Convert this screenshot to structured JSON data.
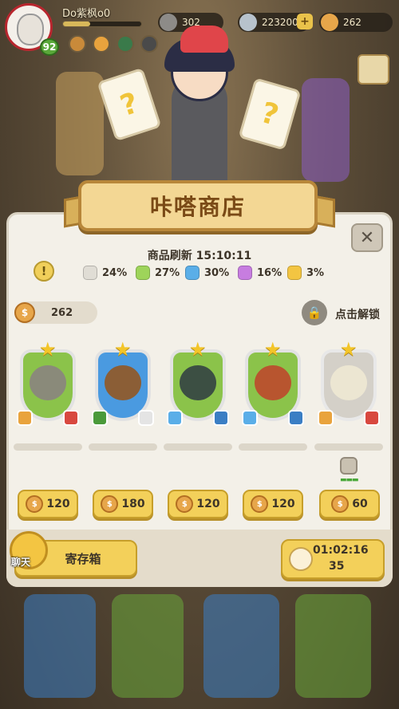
{
  "player": {
    "name": "Do紫枫o0",
    "level": "92"
  },
  "resources": [
    {
      "name": "stamina",
      "value": "302",
      "icon": "energy-icon"
    },
    {
      "name": "stones",
      "value": "223200",
      "icon": "stone-icon"
    },
    {
      "name": "coins",
      "value": "262",
      "icon": "coin-icon"
    }
  ],
  "shop": {
    "title": "咔嗒商店",
    "refresh": "商品刷新 15:10:11",
    "rates": [
      {
        "color": "#e0ddd5",
        "value": "24%"
      },
      {
        "color": "#9ed45a",
        "value": "27%"
      },
      {
        "color": "#5aaee8",
        "value": "30%"
      },
      {
        "color": "#c77de0",
        "value": "16%"
      },
      {
        "color": "#f3c542",
        "value": "3%"
      }
    ],
    "coins": "262",
    "unlock_label": "点击解锁",
    "coin_glyph": "$"
  },
  "pets": [
    {
      "frame": "#8bc34a",
      "body": "#8a8a7a",
      "price": "120"
    },
    {
      "frame": "#4a9ae0",
      "body": "#8b5e36",
      "price": "180"
    },
    {
      "frame": "#8bc34a",
      "body": "#3c4f43",
      "price": "120"
    },
    {
      "frame": "#8bc34a",
      "body": "#b8552f",
      "price": "120"
    },
    {
      "frame": "#d4d0c8",
      "body": "#ece6d2",
      "price": "60"
    }
  ],
  "bottom": {
    "chat_label": "聊天",
    "storage_label": "寄存箱",
    "timer": "01:02:16",
    "timer_count": "35"
  },
  "colors": {
    "accent": "#f3d05a",
    "banner": "#f3d794",
    "panel": "#f3f0e8"
  }
}
